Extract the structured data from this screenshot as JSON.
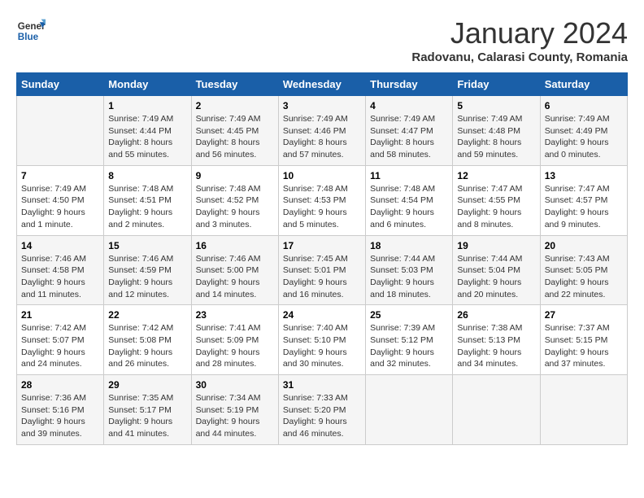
{
  "logo": {
    "line1": "General",
    "line2": "Blue"
  },
  "title": "January 2024",
  "location": "Radovanu, Calarasi County, Romania",
  "days_of_week": [
    "Sunday",
    "Monday",
    "Tuesday",
    "Wednesday",
    "Thursday",
    "Friday",
    "Saturday"
  ],
  "weeks": [
    [
      {
        "num": "",
        "info": ""
      },
      {
        "num": "1",
        "info": "Sunrise: 7:49 AM\nSunset: 4:44 PM\nDaylight: 8 hours\nand 55 minutes."
      },
      {
        "num": "2",
        "info": "Sunrise: 7:49 AM\nSunset: 4:45 PM\nDaylight: 8 hours\nand 56 minutes."
      },
      {
        "num": "3",
        "info": "Sunrise: 7:49 AM\nSunset: 4:46 PM\nDaylight: 8 hours\nand 57 minutes."
      },
      {
        "num": "4",
        "info": "Sunrise: 7:49 AM\nSunset: 4:47 PM\nDaylight: 8 hours\nand 58 minutes."
      },
      {
        "num": "5",
        "info": "Sunrise: 7:49 AM\nSunset: 4:48 PM\nDaylight: 8 hours\nand 59 minutes."
      },
      {
        "num": "6",
        "info": "Sunrise: 7:49 AM\nSunset: 4:49 PM\nDaylight: 9 hours\nand 0 minutes."
      }
    ],
    [
      {
        "num": "7",
        "info": "Sunrise: 7:49 AM\nSunset: 4:50 PM\nDaylight: 9 hours\nand 1 minute."
      },
      {
        "num": "8",
        "info": "Sunrise: 7:48 AM\nSunset: 4:51 PM\nDaylight: 9 hours\nand 2 minutes."
      },
      {
        "num": "9",
        "info": "Sunrise: 7:48 AM\nSunset: 4:52 PM\nDaylight: 9 hours\nand 3 minutes."
      },
      {
        "num": "10",
        "info": "Sunrise: 7:48 AM\nSunset: 4:53 PM\nDaylight: 9 hours\nand 5 minutes."
      },
      {
        "num": "11",
        "info": "Sunrise: 7:48 AM\nSunset: 4:54 PM\nDaylight: 9 hours\nand 6 minutes."
      },
      {
        "num": "12",
        "info": "Sunrise: 7:47 AM\nSunset: 4:55 PM\nDaylight: 9 hours\nand 8 minutes."
      },
      {
        "num": "13",
        "info": "Sunrise: 7:47 AM\nSunset: 4:57 PM\nDaylight: 9 hours\nand 9 minutes."
      }
    ],
    [
      {
        "num": "14",
        "info": "Sunrise: 7:46 AM\nSunset: 4:58 PM\nDaylight: 9 hours\nand 11 minutes."
      },
      {
        "num": "15",
        "info": "Sunrise: 7:46 AM\nSunset: 4:59 PM\nDaylight: 9 hours\nand 12 minutes."
      },
      {
        "num": "16",
        "info": "Sunrise: 7:46 AM\nSunset: 5:00 PM\nDaylight: 9 hours\nand 14 minutes."
      },
      {
        "num": "17",
        "info": "Sunrise: 7:45 AM\nSunset: 5:01 PM\nDaylight: 9 hours\nand 16 minutes."
      },
      {
        "num": "18",
        "info": "Sunrise: 7:44 AM\nSunset: 5:03 PM\nDaylight: 9 hours\nand 18 minutes."
      },
      {
        "num": "19",
        "info": "Sunrise: 7:44 AM\nSunset: 5:04 PM\nDaylight: 9 hours\nand 20 minutes."
      },
      {
        "num": "20",
        "info": "Sunrise: 7:43 AM\nSunset: 5:05 PM\nDaylight: 9 hours\nand 22 minutes."
      }
    ],
    [
      {
        "num": "21",
        "info": "Sunrise: 7:42 AM\nSunset: 5:07 PM\nDaylight: 9 hours\nand 24 minutes."
      },
      {
        "num": "22",
        "info": "Sunrise: 7:42 AM\nSunset: 5:08 PM\nDaylight: 9 hours\nand 26 minutes."
      },
      {
        "num": "23",
        "info": "Sunrise: 7:41 AM\nSunset: 5:09 PM\nDaylight: 9 hours\nand 28 minutes."
      },
      {
        "num": "24",
        "info": "Sunrise: 7:40 AM\nSunset: 5:10 PM\nDaylight: 9 hours\nand 30 minutes."
      },
      {
        "num": "25",
        "info": "Sunrise: 7:39 AM\nSunset: 5:12 PM\nDaylight: 9 hours\nand 32 minutes."
      },
      {
        "num": "26",
        "info": "Sunrise: 7:38 AM\nSunset: 5:13 PM\nDaylight: 9 hours\nand 34 minutes."
      },
      {
        "num": "27",
        "info": "Sunrise: 7:37 AM\nSunset: 5:15 PM\nDaylight: 9 hours\nand 37 minutes."
      }
    ],
    [
      {
        "num": "28",
        "info": "Sunrise: 7:36 AM\nSunset: 5:16 PM\nDaylight: 9 hours\nand 39 minutes."
      },
      {
        "num": "29",
        "info": "Sunrise: 7:35 AM\nSunset: 5:17 PM\nDaylight: 9 hours\nand 41 minutes."
      },
      {
        "num": "30",
        "info": "Sunrise: 7:34 AM\nSunset: 5:19 PM\nDaylight: 9 hours\nand 44 minutes."
      },
      {
        "num": "31",
        "info": "Sunrise: 7:33 AM\nSunset: 5:20 PM\nDaylight: 9 hours\nand 46 minutes."
      },
      {
        "num": "",
        "info": ""
      },
      {
        "num": "",
        "info": ""
      },
      {
        "num": "",
        "info": ""
      }
    ]
  ]
}
